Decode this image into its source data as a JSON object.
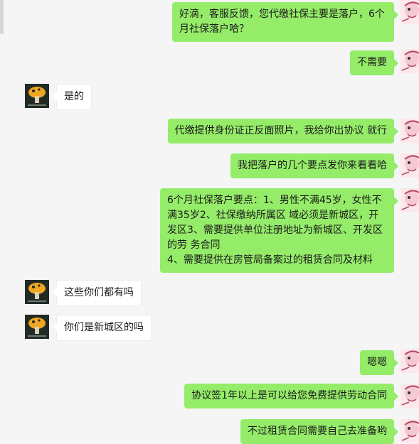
{
  "messages": [
    {
      "sender": "me",
      "text": "好滴，客服反馈，您代缴社保主要是落户，6个月社保落户哈？"
    },
    {
      "sender": "me",
      "text": "不需要"
    },
    {
      "sender": "other",
      "text": "是的"
    },
    {
      "sender": "me",
      "text": "代缴提供身份证正反面照片，我给你出协议 就行"
    },
    {
      "sender": "me",
      "text": "我把落户的几个要点发你来看看哈"
    },
    {
      "sender": "me",
      "text": "6个月社保落户要点：1、男性不满45岁，女性不满35岁2、社保缴纳所属区 域必须是新城区，开发区3、需要提供单位注册地址为新城区、开发区的劳 务合同\n4、需要提供在房管局备案过的租赁合同及材料"
    },
    {
      "sender": "other",
      "text": "这些你们都有吗"
    },
    {
      "sender": "other",
      "text": "你们是新城区的吗"
    },
    {
      "sender": "me",
      "text": "嗯嗯"
    },
    {
      "sender": "me",
      "text": "协议签1年以上是可以给您免费提供劳动合同"
    },
    {
      "sender": "me",
      "text": "不过租赁合同需要自己去准备哟"
    }
  ],
  "colors": {
    "my_bubble": "#95ec69",
    "other_bubble": "#ffffff",
    "background": "#f5f5f5"
  },
  "avatars": {
    "me": "pink-cartoon-avatar",
    "other": "mushroom-logo-avatar"
  }
}
